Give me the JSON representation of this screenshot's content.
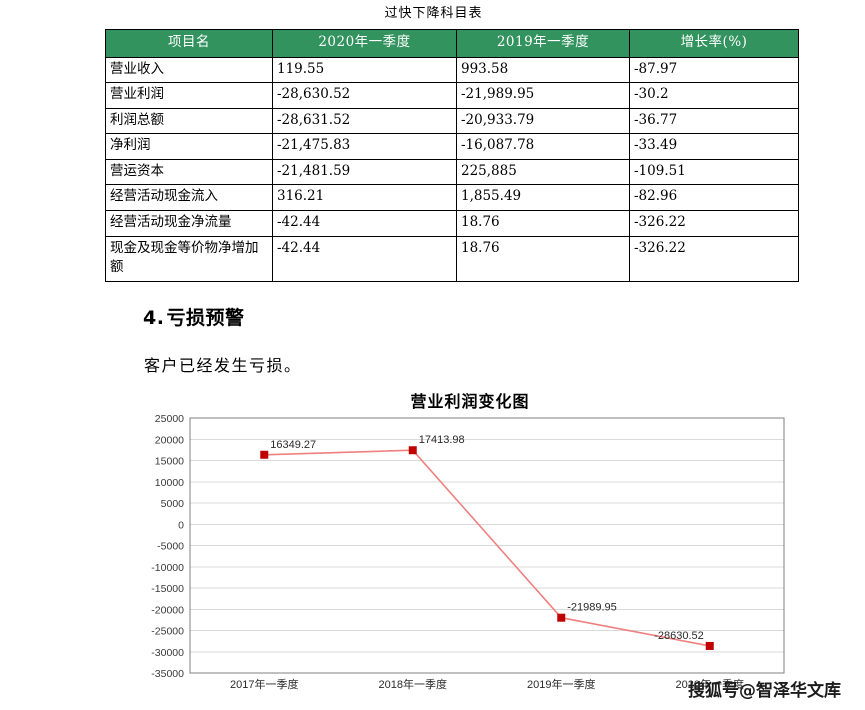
{
  "document": {
    "table_caption": "过快下降科目表",
    "table": {
      "headers": [
        "项目名",
        "2020年一季度",
        "2019年一季度",
        "增长率(%)"
      ],
      "rows": [
        {
          "name": "营业收入",
          "y2020": "119.55",
          "y2019": "993.58",
          "rate": "-87.97"
        },
        {
          "name": "营业利润",
          "y2020": "-28,630.52",
          "y2019": "-21,989.95",
          "rate": "-30.2"
        },
        {
          "name": "利润总额",
          "y2020": "-28,631.52",
          "y2019": "-20,933.79",
          "rate": "-36.77"
        },
        {
          "name": "净利润",
          "y2020": "-21,475.83",
          "y2019": "-16,087.78",
          "rate": "-33.49"
        },
        {
          "name": "营运资本",
          "y2020": "-21,481.59",
          "y2019": "225,885",
          "rate": "-109.51"
        },
        {
          "name": "经营活动现金流入",
          "y2020": "316.21",
          "y2019": "1,855.49",
          "rate": "-82.96"
        },
        {
          "name": "经营活动现金净流量",
          "y2020": "-42.44",
          "y2019": "18.76",
          "rate": "-326.22"
        },
        {
          "name": "现金及现金等价物净增加额",
          "y2020": "-42.44",
          "y2019": "18.76",
          "rate": "-326.22"
        }
      ]
    },
    "section": {
      "number": "4.",
      "heading": "亏损预警",
      "paragraph": "客户已经发生亏损。"
    },
    "watermark": "搜狐号@智泽华文库"
  },
  "chart_data": {
    "type": "line",
    "title": "营业利润变化图",
    "xlabel": "",
    "ylabel": "",
    "categories": [
      "2017年一季度",
      "2018年一季度",
      "2019年一季度",
      "2020年一季度"
    ],
    "values": [
      16349.27,
      17413.98,
      -21989.95,
      -28630.52
    ],
    "point_labels": [
      "16349.27",
      "17413.98",
      "-21989.95",
      "-28630.52"
    ],
    "ylim": [
      -35000,
      25000
    ],
    "ytick_step": 5000,
    "yticks": [
      25000,
      20000,
      15000,
      10000,
      5000,
      0,
      -5000,
      -10000,
      -15000,
      -20000,
      -25000,
      -30000,
      -35000
    ],
    "ytick_labels": [
      "25000",
      "20000",
      "15000",
      "10000",
      "5000",
      "0",
      "-5000",
      "-10000",
      "-15000",
      "-20000",
      "-25000",
      "-30000",
      "-35000"
    ],
    "grid": true,
    "legend": false,
    "series_color": "#f08080",
    "marker_color": "#c00000",
    "plot_border_color": "#808080",
    "grid_color": "#d9d9d9"
  },
  "colors": {
    "table_header_bg": "#32935e",
    "table_header_text": "#ffffff",
    "table_border": "#000000",
    "text": "#000000"
  }
}
